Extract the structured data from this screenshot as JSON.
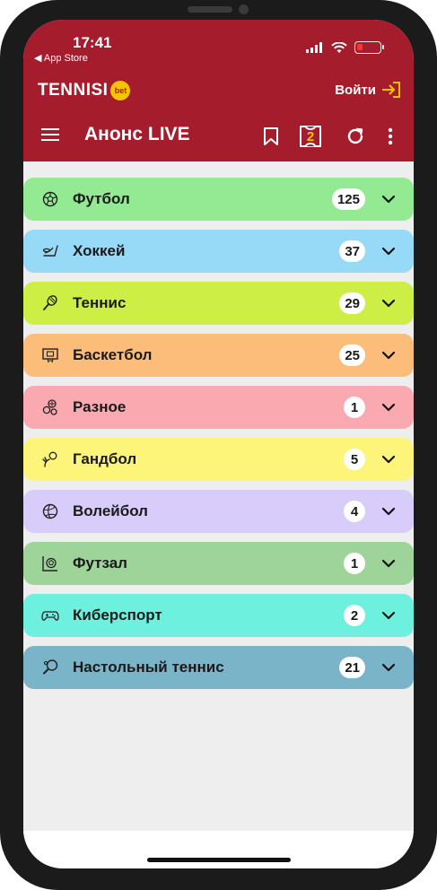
{
  "status": {
    "time": "17:41",
    "back_label": "◀ App Store"
  },
  "brand": {
    "name": "TENNISI",
    "badge": "bet"
  },
  "header": {
    "login_label": "Войти",
    "title": "Анонс LIVE",
    "coupon_count": "2"
  },
  "colors": {
    "header_bg": "#a51c2d",
    "accent_yellow": "#f5c400"
  },
  "sports": [
    {
      "name": "Футбол",
      "count": "125",
      "icon": "soccer-ball-icon",
      "color": "#93ea93"
    },
    {
      "name": "Хоккей",
      "count": "37",
      "icon": "hockey-icon",
      "color": "#97daf8"
    },
    {
      "name": "Теннис",
      "count": "29",
      "icon": "tennis-icon",
      "color": "#cdef45"
    },
    {
      "name": "Баскетбол",
      "count": "25",
      "icon": "basketball-icon",
      "color": "#fcbc7a"
    },
    {
      "name": "Разное",
      "count": "1",
      "icon": "misc-sports-icon",
      "color": "#fba9b1"
    },
    {
      "name": "Гандбол",
      "count": "5",
      "icon": "handball-icon",
      "color": "#fdf57a"
    },
    {
      "name": "Волейбол",
      "count": "4",
      "icon": "volleyball-icon",
      "color": "#d7ccfa"
    },
    {
      "name": "Футзал",
      "count": "1",
      "icon": "futsal-icon",
      "color": "#9ed39a"
    },
    {
      "name": "Киберспорт",
      "count": "2",
      "icon": "gamepad-icon",
      "color": "#6df0de"
    },
    {
      "name": "Настольный теннис",
      "count": "21",
      "icon": "table-tennis-icon",
      "color": "#79b4c8"
    }
  ]
}
